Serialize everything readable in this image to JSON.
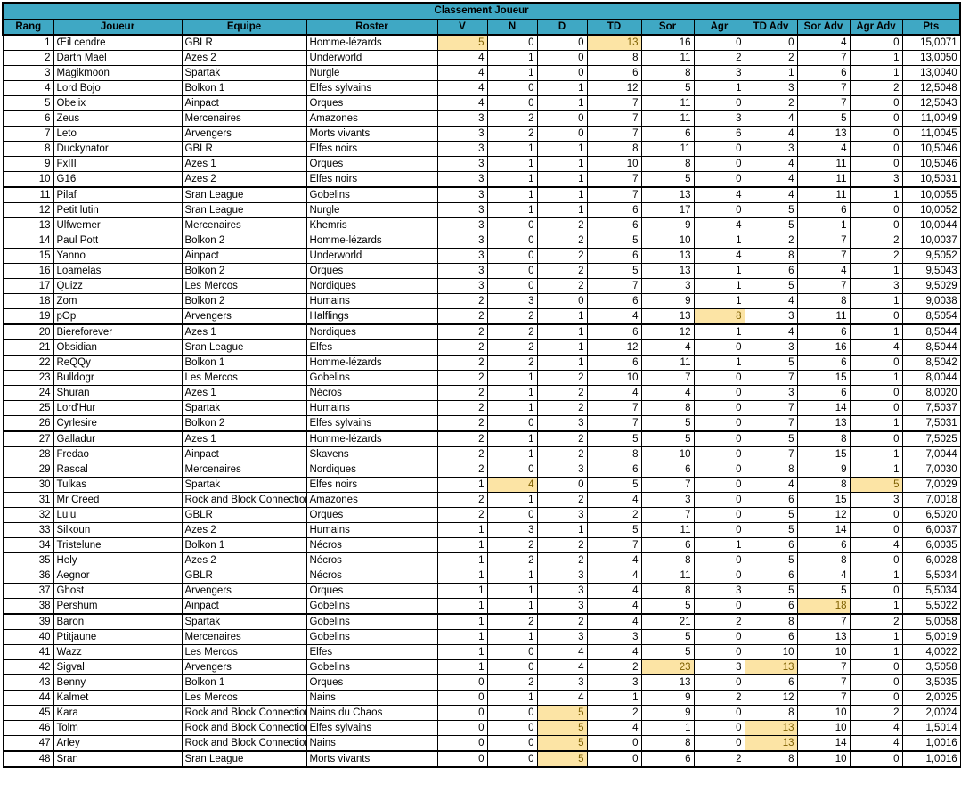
{
  "title": "Classement Joueur",
  "accent_color": "#3FA8C4",
  "highlight_color": "#FCE4A5",
  "highlight_text_color": "#7E6000",
  "columns": [
    "Rang",
    "Joueur",
    "Equipe",
    "Roster",
    "V",
    "N",
    "D",
    "TD",
    "Sor",
    "Agr",
    "TD Adv",
    "Sor Adv",
    "Agr Adv",
    "Pts"
  ],
  "section_breaks_after_rank": [
    10,
    19,
    26,
    38,
    47
  ],
  "rows": [
    {
      "rang": "1",
      "joueur": "Œil cendre",
      "equipe": "GBLR",
      "roster": "Homme-lézards",
      "v": "5",
      "n": "0",
      "d": "0",
      "td": "13",
      "sor": "16",
      "agr": "0",
      "tdadv": "0",
      "soradv": "4",
      "agradv": "0",
      "pts": "15,0071",
      "hl": [
        "v",
        "td"
      ]
    },
    {
      "rang": "2",
      "joueur": "Darth Mael",
      "equipe": "Azes 2",
      "roster": "Underworld",
      "v": "4",
      "n": "1",
      "d": "0",
      "td": "8",
      "sor": "11",
      "agr": "2",
      "tdadv": "2",
      "soradv": "7",
      "agradv": "1",
      "pts": "13,0050",
      "hl": []
    },
    {
      "rang": "3",
      "joueur": "Magikmoon",
      "equipe": "Spartak",
      "roster": "Nurgle",
      "v": "4",
      "n": "1",
      "d": "0",
      "td": "6",
      "sor": "8",
      "agr": "3",
      "tdadv": "1",
      "soradv": "6",
      "agradv": "1",
      "pts": "13,0040",
      "hl": []
    },
    {
      "rang": "4",
      "joueur": "Lord Bojo",
      "equipe": "Bolkon 1",
      "roster": "Elfes sylvains",
      "v": "4",
      "n": "0",
      "d": "1",
      "td": "12",
      "sor": "5",
      "agr": "1",
      "tdadv": "3",
      "soradv": "7",
      "agradv": "2",
      "pts": "12,5048",
      "hl": []
    },
    {
      "rang": "5",
      "joueur": "Obelix",
      "equipe": "Ainpact",
      "roster": "Orques",
      "v": "4",
      "n": "0",
      "d": "1",
      "td": "7",
      "sor": "11",
      "agr": "0",
      "tdadv": "2",
      "soradv": "7",
      "agradv": "0",
      "pts": "12,5043",
      "hl": []
    },
    {
      "rang": "6",
      "joueur": "Zeus",
      "equipe": "Mercenaires",
      "roster": "Amazones",
      "v": "3",
      "n": "2",
      "d": "0",
      "td": "7",
      "sor": "11",
      "agr": "3",
      "tdadv": "4",
      "soradv": "5",
      "agradv": "0",
      "pts": "11,0049",
      "hl": []
    },
    {
      "rang": "7",
      "joueur": "Leto",
      "equipe": "Arvengers",
      "roster": "Morts vivants",
      "v": "3",
      "n": "2",
      "d": "0",
      "td": "7",
      "sor": "6",
      "agr": "6",
      "tdadv": "4",
      "soradv": "13",
      "agradv": "0",
      "pts": "11,0045",
      "hl": []
    },
    {
      "rang": "8",
      "joueur": "Duckynator",
      "equipe": "GBLR",
      "roster": "Elfes noirs",
      "v": "3",
      "n": "1",
      "d": "1",
      "td": "8",
      "sor": "11",
      "agr": "0",
      "tdadv": "3",
      "soradv": "4",
      "agradv": "0",
      "pts": "10,5046",
      "hl": []
    },
    {
      "rang": "9",
      "joueur": "FxIII",
      "equipe": "Azes 1",
      "roster": "Orques",
      "v": "3",
      "n": "1",
      "d": "1",
      "td": "10",
      "sor": "8",
      "agr": "0",
      "tdadv": "4",
      "soradv": "11",
      "agradv": "0",
      "pts": "10,5046",
      "hl": []
    },
    {
      "rang": "10",
      "joueur": "G16",
      "equipe": "Azes 2",
      "roster": "Elfes noirs",
      "v": "3",
      "n": "1",
      "d": "1",
      "td": "7",
      "sor": "5",
      "agr": "0",
      "tdadv": "4",
      "soradv": "11",
      "agradv": "3",
      "pts": "10,5031",
      "hl": []
    },
    {
      "rang": "11",
      "joueur": "Pilaf",
      "equipe": "Sran League",
      "roster": "Gobelins",
      "v": "3",
      "n": "1",
      "d": "1",
      "td": "7",
      "sor": "13",
      "agr": "4",
      "tdadv": "4",
      "soradv": "11",
      "agradv": "1",
      "pts": "10,0055",
      "hl": []
    },
    {
      "rang": "12",
      "joueur": "Petit lutin",
      "equipe": "Sran League",
      "roster": "Nurgle",
      "v": "3",
      "n": "1",
      "d": "1",
      "td": "6",
      "sor": "17",
      "agr": "0",
      "tdadv": "5",
      "soradv": "6",
      "agradv": "0",
      "pts": "10,0052",
      "hl": []
    },
    {
      "rang": "13",
      "joueur": "Ulfwerner",
      "equipe": "Mercenaires",
      "roster": "Khemris",
      "v": "3",
      "n": "0",
      "d": "2",
      "td": "6",
      "sor": "9",
      "agr": "4",
      "tdadv": "5",
      "soradv": "1",
      "agradv": "0",
      "pts": "10,0044",
      "hl": []
    },
    {
      "rang": "14",
      "joueur": "Paul Pott",
      "equipe": "Bolkon 2",
      "roster": "Homme-lézards",
      "v": "3",
      "n": "0",
      "d": "2",
      "td": "5",
      "sor": "10",
      "agr": "1",
      "tdadv": "2",
      "soradv": "7",
      "agradv": "2",
      "pts": "10,0037",
      "hl": []
    },
    {
      "rang": "15",
      "joueur": "Yanno",
      "equipe": "Ainpact",
      "roster": "Underworld",
      "v": "3",
      "n": "0",
      "d": "2",
      "td": "6",
      "sor": "13",
      "agr": "4",
      "tdadv": "8",
      "soradv": "7",
      "agradv": "2",
      "pts": "9,5052",
      "hl": []
    },
    {
      "rang": "16",
      "joueur": "Loamelas",
      "equipe": "Bolkon 2",
      "roster": "Orques",
      "v": "3",
      "n": "0",
      "d": "2",
      "td": "5",
      "sor": "13",
      "agr": "1",
      "tdadv": "6",
      "soradv": "4",
      "agradv": "1",
      "pts": "9,5043",
      "hl": []
    },
    {
      "rang": "17",
      "joueur": "Quizz",
      "equipe": "Les Mercos",
      "roster": "Nordiques",
      "v": "3",
      "n": "0",
      "d": "2",
      "td": "7",
      "sor": "3",
      "agr": "1",
      "tdadv": "5",
      "soradv": "7",
      "agradv": "3",
      "pts": "9,5029",
      "hl": []
    },
    {
      "rang": "18",
      "joueur": "Zom",
      "equipe": "Bolkon 2",
      "roster": "Humains",
      "v": "2",
      "n": "3",
      "d": "0",
      "td": "6",
      "sor": "9",
      "agr": "1",
      "tdadv": "4",
      "soradv": "8",
      "agradv": "1",
      "pts": "9,0038",
      "hl": []
    },
    {
      "rang": "19",
      "joueur": "pOp",
      "equipe": "Arvengers",
      "roster": "Halflings",
      "v": "2",
      "n": "2",
      "d": "1",
      "td": "4",
      "sor": "13",
      "agr": "8",
      "tdadv": "3",
      "soradv": "11",
      "agradv": "0",
      "pts": "8,5054",
      "hl": [
        "agr"
      ]
    },
    {
      "rang": "20",
      "joueur": "Biereforever",
      "equipe": "Azes 1",
      "roster": "Nordiques",
      "v": "2",
      "n": "2",
      "d": "1",
      "td": "6",
      "sor": "12",
      "agr": "1",
      "tdadv": "4",
      "soradv": "6",
      "agradv": "1",
      "pts": "8,5044",
      "hl": []
    },
    {
      "rang": "21",
      "joueur": "Obsidian",
      "equipe": "Sran League",
      "roster": "Elfes",
      "v": "2",
      "n": "2",
      "d": "1",
      "td": "12",
      "sor": "4",
      "agr": "0",
      "tdadv": "3",
      "soradv": "16",
      "agradv": "4",
      "pts": "8,5044",
      "hl": []
    },
    {
      "rang": "22",
      "joueur": "ReQQy",
      "equipe": "Bolkon 1",
      "roster": "Homme-lézards",
      "v": "2",
      "n": "2",
      "d": "1",
      "td": "6",
      "sor": "11",
      "agr": "1",
      "tdadv": "5",
      "soradv": "6",
      "agradv": "0",
      "pts": "8,5042",
      "hl": []
    },
    {
      "rang": "23",
      "joueur": "Bulldogr",
      "equipe": "Les Mercos",
      "roster": "Gobelins",
      "v": "2",
      "n": "1",
      "d": "2",
      "td": "10",
      "sor": "7",
      "agr": "0",
      "tdadv": "7",
      "soradv": "15",
      "agradv": "1",
      "pts": "8,0044",
      "hl": []
    },
    {
      "rang": "24",
      "joueur": "Shuran",
      "equipe": "Azes 1",
      "roster": "Nécros",
      "v": "2",
      "n": "1",
      "d": "2",
      "td": "4",
      "sor": "4",
      "agr": "0",
      "tdadv": "3",
      "soradv": "6",
      "agradv": "0",
      "pts": "8,0020",
      "hl": []
    },
    {
      "rang": "25",
      "joueur": "Lord'Hur",
      "equipe": "Spartak",
      "roster": "Humains",
      "v": "2",
      "n": "1",
      "d": "2",
      "td": "7",
      "sor": "8",
      "agr": "0",
      "tdadv": "7",
      "soradv": "14",
      "agradv": "0",
      "pts": "7,5037",
      "hl": []
    },
    {
      "rang": "26",
      "joueur": "Cyrlesire",
      "equipe": "Bolkon 2",
      "roster": "Elfes sylvains",
      "v": "2",
      "n": "0",
      "d": "3",
      "td": "7",
      "sor": "5",
      "agr": "0",
      "tdadv": "7",
      "soradv": "13",
      "agradv": "1",
      "pts": "7,5031",
      "hl": []
    },
    {
      "rang": "27",
      "joueur": "Galladur",
      "equipe": "Azes 1",
      "roster": "Homme-lézards",
      "v": "2",
      "n": "1",
      "d": "2",
      "td": "5",
      "sor": "5",
      "agr": "0",
      "tdadv": "5",
      "soradv": "8",
      "agradv": "0",
      "pts": "7,5025",
      "hl": []
    },
    {
      "rang": "28",
      "joueur": "Fredao",
      "equipe": "Ainpact",
      "roster": "Skavens",
      "v": "2",
      "n": "1",
      "d": "2",
      "td": "8",
      "sor": "10",
      "agr": "0",
      "tdadv": "7",
      "soradv": "15",
      "agradv": "1",
      "pts": "7,0044",
      "hl": []
    },
    {
      "rang": "29",
      "joueur": "Rascal",
      "equipe": "Mercenaires",
      "roster": "Nordiques",
      "v": "2",
      "n": "0",
      "d": "3",
      "td": "6",
      "sor": "6",
      "agr": "0",
      "tdadv": "8",
      "soradv": "9",
      "agradv": "1",
      "pts": "7,0030",
      "hl": []
    },
    {
      "rang": "30",
      "joueur": "Tulkas",
      "equipe": "Spartak",
      "roster": "Elfes noirs",
      "v": "1",
      "n": "4",
      "d": "0",
      "td": "5",
      "sor": "7",
      "agr": "0",
      "tdadv": "4",
      "soradv": "8",
      "agradv": "5",
      "pts": "7,0029",
      "hl": [
        "n",
        "agradv"
      ]
    },
    {
      "rang": "31",
      "joueur": "Mr Creed",
      "equipe": "Rock and Block Connection",
      "roster": "Amazones",
      "v": "2",
      "n": "1",
      "d": "2",
      "td": "4",
      "sor": "3",
      "agr": "0",
      "tdadv": "6",
      "soradv": "15",
      "agradv": "3",
      "pts": "7,0018",
      "hl": []
    },
    {
      "rang": "32",
      "joueur": "Lulu",
      "equipe": "GBLR",
      "roster": "Orques",
      "v": "2",
      "n": "0",
      "d": "3",
      "td": "2",
      "sor": "7",
      "agr": "0",
      "tdadv": "5",
      "soradv": "12",
      "agradv": "0",
      "pts": "6,5020",
      "hl": []
    },
    {
      "rang": "33",
      "joueur": "Silkoun",
      "equipe": "Azes 2",
      "roster": "Humains",
      "v": "1",
      "n": "3",
      "d": "1",
      "td": "5",
      "sor": "11",
      "agr": "0",
      "tdadv": "5",
      "soradv": "14",
      "agradv": "0",
      "pts": "6,0037",
      "hl": []
    },
    {
      "rang": "34",
      "joueur": "Tristelune",
      "equipe": "Bolkon 1",
      "roster": "Nécros",
      "v": "1",
      "n": "2",
      "d": "2",
      "td": "7",
      "sor": "6",
      "agr": "1",
      "tdadv": "6",
      "soradv": "6",
      "agradv": "4",
      "pts": "6,0035",
      "hl": []
    },
    {
      "rang": "35",
      "joueur": "Hely",
      "equipe": "Azes 2",
      "roster": "Nécros",
      "v": "1",
      "n": "2",
      "d": "2",
      "td": "4",
      "sor": "8",
      "agr": "0",
      "tdadv": "5",
      "soradv": "8",
      "agradv": "0",
      "pts": "6,0028",
      "hl": []
    },
    {
      "rang": "36",
      "joueur": "Aegnor",
      "equipe": "GBLR",
      "roster": "Nécros",
      "v": "1",
      "n": "1",
      "d": "3",
      "td": "4",
      "sor": "11",
      "agr": "0",
      "tdadv": "6",
      "soradv": "4",
      "agradv": "1",
      "pts": "5,5034",
      "hl": []
    },
    {
      "rang": "37",
      "joueur": "Ghost",
      "equipe": "Arvengers",
      "roster": "Orques",
      "v": "1",
      "n": "1",
      "d": "3",
      "td": "4",
      "sor": "8",
      "agr": "3",
      "tdadv": "5",
      "soradv": "5",
      "agradv": "0",
      "pts": "5,5034",
      "hl": []
    },
    {
      "rang": "38",
      "joueur": "Pershum",
      "equipe": "Ainpact",
      "roster": "Gobelins",
      "v": "1",
      "n": "1",
      "d": "3",
      "td": "4",
      "sor": "5",
      "agr": "0",
      "tdadv": "6",
      "soradv": "18",
      "agradv": "1",
      "pts": "5,5022",
      "hl": [
        "soradv"
      ]
    },
    {
      "rang": "39",
      "joueur": "Baron",
      "equipe": "Spartak",
      "roster": "Gobelins",
      "v": "1",
      "n": "2",
      "d": "2",
      "td": "4",
      "sor": "21",
      "agr": "2",
      "tdadv": "8",
      "soradv": "7",
      "agradv": "2",
      "pts": "5,0058",
      "hl": []
    },
    {
      "rang": "40",
      "joueur": "Ptitjaune",
      "equipe": "Mercenaires",
      "roster": "Gobelins",
      "v": "1",
      "n": "1",
      "d": "3",
      "td": "3",
      "sor": "5",
      "agr": "0",
      "tdadv": "6",
      "soradv": "13",
      "agradv": "1",
      "pts": "5,0019",
      "hl": []
    },
    {
      "rang": "41",
      "joueur": "Wazz",
      "equipe": "Les Mercos",
      "roster": "Elfes",
      "v": "1",
      "n": "0",
      "d": "4",
      "td": "4",
      "sor": "5",
      "agr": "0",
      "tdadv": "10",
      "soradv": "10",
      "agradv": "1",
      "pts": "4,0022",
      "hl": []
    },
    {
      "rang": "42",
      "joueur": "Sigval",
      "equipe": "Arvengers",
      "roster": "Gobelins",
      "v": "1",
      "n": "0",
      "d": "4",
      "td": "2",
      "sor": "23",
      "agr": "3",
      "tdadv": "13",
      "soradv": "7",
      "agradv": "0",
      "pts": "3,5058",
      "hl": [
        "sor",
        "tdadv"
      ]
    },
    {
      "rang": "43",
      "joueur": "Benny",
      "equipe": "Bolkon 1",
      "roster": "Orques",
      "v": "0",
      "n": "2",
      "d": "3",
      "td": "3",
      "sor": "13",
      "agr": "0",
      "tdadv": "6",
      "soradv": "7",
      "agradv": "0",
      "pts": "3,5035",
      "hl": []
    },
    {
      "rang": "44",
      "joueur": "Kalmet",
      "equipe": "Les Mercos",
      "roster": "Nains",
      "v": "0",
      "n": "1",
      "d": "4",
      "td": "1",
      "sor": "9",
      "agr": "2",
      "tdadv": "12",
      "soradv": "7",
      "agradv": "0",
      "pts": "2,0025",
      "hl": []
    },
    {
      "rang": "45",
      "joueur": "Kara",
      "equipe": "Rock and Block Connection",
      "roster": "Nains du Chaos",
      "v": "0",
      "n": "0",
      "d": "5",
      "td": "2",
      "sor": "9",
      "agr": "0",
      "tdadv": "8",
      "soradv": "10",
      "agradv": "2",
      "pts": "2,0024",
      "hl": [
        "d"
      ]
    },
    {
      "rang": "46",
      "joueur": "Tolm",
      "equipe": "Rock and Block Connection",
      "roster": "Elfes sylvains",
      "v": "0",
      "n": "0",
      "d": "5",
      "td": "4",
      "sor": "1",
      "agr": "0",
      "tdadv": "13",
      "soradv": "10",
      "agradv": "4",
      "pts": "1,5014",
      "hl": [
        "d",
        "tdadv"
      ]
    },
    {
      "rang": "47",
      "joueur": "Arley",
      "equipe": "Rock and Block Connection",
      "roster": "Nains",
      "v": "0",
      "n": "0",
      "d": "5",
      "td": "0",
      "sor": "8",
      "agr": "0",
      "tdadv": "13",
      "soradv": "14",
      "agradv": "4",
      "pts": "1,0016",
      "hl": [
        "d",
        "tdadv"
      ]
    },
    {
      "rang": "48",
      "joueur": "Sran",
      "equipe": "Sran League",
      "roster": "Morts vivants",
      "v": "0",
      "n": "0",
      "d": "5",
      "td": "0",
      "sor": "6",
      "agr": "2",
      "tdadv": "8",
      "soradv": "10",
      "agradv": "0",
      "pts": "1,0016",
      "hl": [
        "d"
      ]
    }
  ]
}
